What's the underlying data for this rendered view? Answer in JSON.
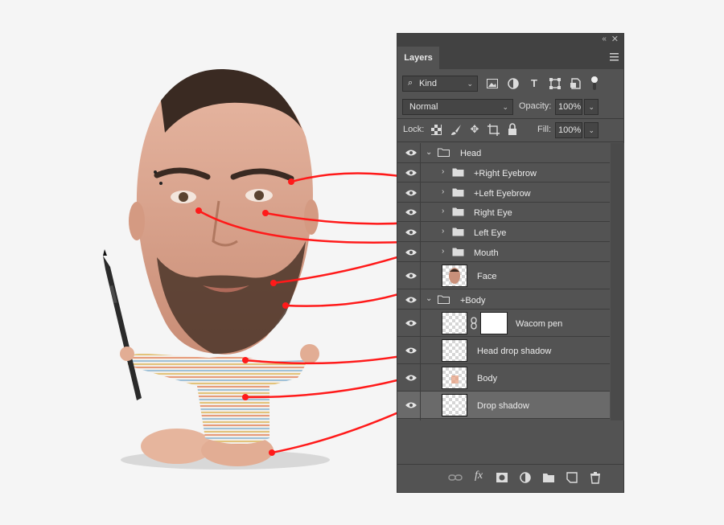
{
  "panel": {
    "tab_label": "Layers",
    "collapse_glyph": "‹‹",
    "close_glyph": "✕",
    "filter": {
      "kind_label": "Kind"
    },
    "blend": {
      "mode": "Normal",
      "opacity_label": "Opacity:",
      "opacity_value": "100%"
    },
    "lock": {
      "label": "Lock:",
      "fill_label": "Fill:",
      "fill_value": "100%"
    }
  },
  "layers": [
    {
      "name": "Head",
      "type": "group",
      "expanded": true,
      "indent": 0
    },
    {
      "name": "+Right Eyebrow",
      "type": "group",
      "expanded": false,
      "indent": 1
    },
    {
      "name": "+Left Eyebrow",
      "type": "group",
      "expanded": false,
      "indent": 1
    },
    {
      "name": "Right Eye",
      "type": "group",
      "expanded": false,
      "indent": 1
    },
    {
      "name": "Left Eye",
      "type": "group",
      "expanded": false,
      "indent": 1
    },
    {
      "name": "Mouth",
      "type": "group",
      "expanded": false,
      "indent": 1
    },
    {
      "name": "Face",
      "type": "layer",
      "indent": 1
    },
    {
      "name": "+Body",
      "type": "group",
      "expanded": true,
      "indent": 0
    },
    {
      "name": "Wacom pen",
      "type": "layer-mask",
      "indent": 1
    },
    {
      "name": "Head drop shadow",
      "type": "layer",
      "indent": 1
    },
    {
      "name": "Body",
      "type": "layer",
      "indent": 1
    },
    {
      "name": "Drop shadow",
      "type": "layer",
      "indent": 1,
      "selected": true
    }
  ],
  "colors": {
    "panel_bg": "#535353",
    "selected_row": "#6a6a6a",
    "annotation_red": "#ff1a1a",
    "page_bg": "#f5f5f5"
  },
  "icons": [
    "search-icon",
    "image-filter-icon",
    "adjustment-filter-icon",
    "type-filter-icon",
    "shape-filter-icon",
    "smart-object-filter-icon",
    "filter-toggle-icon",
    "lock-transparent-icon",
    "lock-paint-icon",
    "lock-move-icon",
    "lock-artboard-icon",
    "lock-all-icon",
    "eye-icon",
    "folder-icon",
    "chain-link-icon",
    "link-layers-icon",
    "fx-icon",
    "add-mask-icon",
    "new-adjustment-icon",
    "new-group-icon",
    "new-layer-icon",
    "trash-icon"
  ]
}
